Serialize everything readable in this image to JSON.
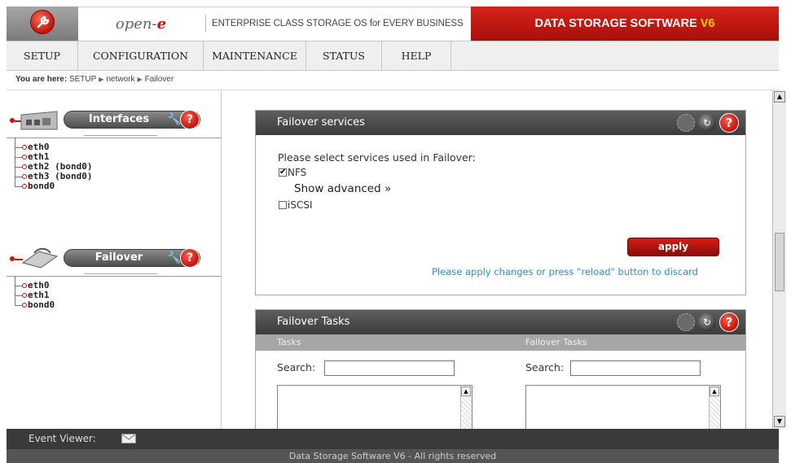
{
  "header": {
    "brand_main": "open-",
    "brand_e": "e",
    "tagline": "ENTERPRISE CLASS STORAGE OS for EVERY BUSINESS",
    "product_main": "DATA STORAGE SOFTWARE ",
    "product_version": "V6"
  },
  "menu": {
    "items": [
      {
        "label": "SETUP"
      },
      {
        "label": "CONFIGURATION"
      },
      {
        "label": "MAINTENANCE"
      },
      {
        "label": "STATUS"
      },
      {
        "label": "HELP"
      }
    ]
  },
  "breadcrumb": {
    "prefix": "You are here:",
    "parts": [
      "SETUP",
      "network",
      "Failover"
    ]
  },
  "sidebar": {
    "interfaces": {
      "title": "Interfaces",
      "items": [
        "eth0",
        "eth1",
        "eth2 (bond0)",
        "eth3 (bond0)",
        "bond0"
      ]
    },
    "failover": {
      "title": "Failover",
      "items": [
        "eth0",
        "eth1",
        "bond0"
      ]
    },
    "help_glyph": "?"
  },
  "failover_services": {
    "title": "Failover services",
    "prompt": "Please select services used in Failover:",
    "services": [
      {
        "label": "NFS",
        "checked": true
      },
      {
        "label": "iSCSI",
        "checked": false
      }
    ],
    "show_advanced": "Show advanced »",
    "apply_label": "apply",
    "note": "Please apply changes or press \"reload\" button to discard"
  },
  "failover_tasks": {
    "title": "Failover Tasks",
    "col_left": "Tasks",
    "col_right": "Failover Tasks",
    "search_label": "Search:"
  },
  "event_viewer": {
    "label": "Event Viewer:"
  },
  "footer": {
    "text": "Data Storage Software V6 - All rights reserved"
  },
  "colors": {
    "accent_red": "#c1140c",
    "link_blue": "#2a8fcf",
    "header_dark": "#3c3c3c"
  }
}
